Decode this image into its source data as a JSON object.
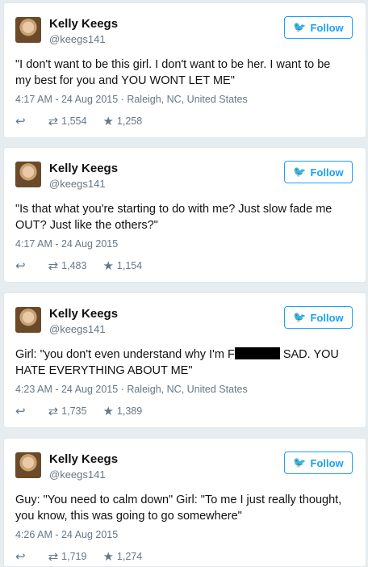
{
  "tweets": [
    {
      "name": "Kelly Keegs",
      "handle": "@keegs141",
      "follow_label": "Follow",
      "text": "\"I don't want to be this girl. I don't want to be her. I want to be my best for you and YOU WONT LET ME\"",
      "time": "4:17 AM - 24 Aug 2015",
      "location": "Raleigh, NC, United States",
      "retweets": "1,554",
      "likes": "1,258"
    },
    {
      "name": "Kelly Keegs",
      "handle": "@keegs141",
      "follow_label": "Follow",
      "text": "\"Is that what you're starting to do with me? Just slow fade me OUT? Just like the others?\"",
      "time": "4:17 AM - 24 Aug 2015",
      "location": "",
      "retweets": "1,483",
      "likes": "1,154"
    },
    {
      "name": "Kelly Keegs",
      "handle": "@keegs141",
      "follow_label": "Follow",
      "text_before": "Girl: \"you don't even understand why I'm F",
      "text_after": " SAD. YOU HATE EVERYTHING ABOUT ME\"",
      "time": "4:23 AM - 24 Aug 2015",
      "location": "Raleigh, NC, United States",
      "retweets": "1,735",
      "likes": "1,389"
    },
    {
      "name": "Kelly Keegs",
      "handle": "@keegs141",
      "follow_label": "Follow",
      "text": "Guy: \"You need to calm down\" Girl: \"To me I just really thought, you know, this was going to go somewhere\"",
      "time": "4:26 AM - 24 Aug 2015",
      "location": "",
      "retweets": "1,719",
      "likes": "1,274"
    }
  ],
  "icons": {
    "twitter_bird": "twitter-bird-icon",
    "reply": "reply-icon",
    "retweet": "retweet-icon",
    "like": "star-icon"
  },
  "colors": {
    "accent": "#1da1f2",
    "muted": "#657786",
    "background": "#e6ecf0"
  }
}
